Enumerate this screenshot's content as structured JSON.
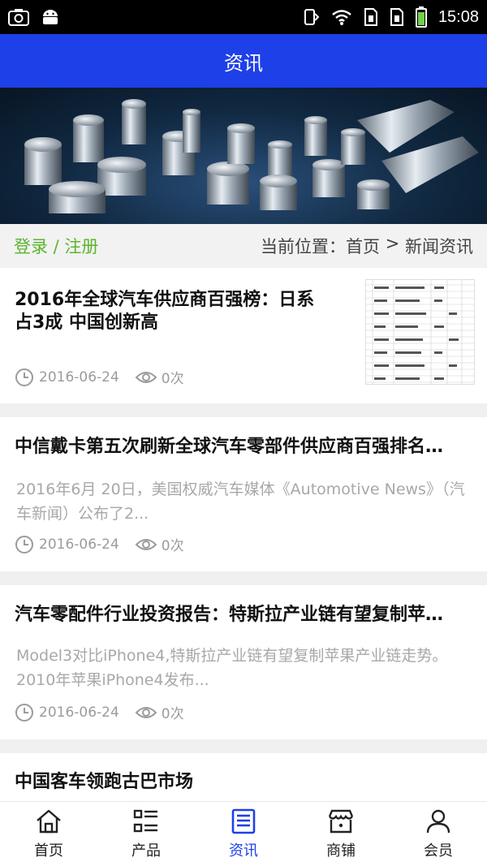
{
  "status_bar": {
    "time": "15:08"
  },
  "header": {
    "title": "资讯"
  },
  "crumb_bar": {
    "login_label": "登录 / 注册",
    "location_prefix": "当前位置：",
    "home": "首页",
    "separator": " > ",
    "current": "新闻资讯"
  },
  "articles": [
    {
      "title": "2016年全球汽车供应商百强榜：日系占3成 中国创新高",
      "title_line1": "2016年全球汽车供应商百强榜：日系",
      "title_line2": "占3成 中国创新高",
      "date": "2016-06-24",
      "views": "0次"
    },
    {
      "title": "中信戴卡第五次刷新全球汽车零部件供应商百强排名…",
      "desc": "2016年6月 20日，美国权威汽车媒体《Automotive News》（汽车新闻）公布了2...",
      "date": "2016-06-24",
      "views": "0次"
    },
    {
      "title": "汽车零配件行业投资报告：特斯拉产业链有望复制苹…",
      "desc": "Model3对比iPhone4,特斯拉产业链有望复制苹果产业链走势。2010年苹果iPhone4发布...",
      "date": "2016-06-24",
      "views": "0次"
    },
    {
      "title": "中国客车领跑古巴市场"
    }
  ],
  "tab_bar": {
    "items": [
      {
        "label": "首页",
        "icon": "home-icon"
      },
      {
        "label": "产品",
        "icon": "list-icon"
      },
      {
        "label": "资讯",
        "icon": "news-icon",
        "active": true
      },
      {
        "label": "商铺",
        "icon": "shop-icon"
      },
      {
        "label": "会员",
        "icon": "user-icon"
      }
    ]
  },
  "colors": {
    "header_bg": "#1e40e8",
    "login_green": "#5ab52e",
    "active_tab": "#1e40e8"
  }
}
